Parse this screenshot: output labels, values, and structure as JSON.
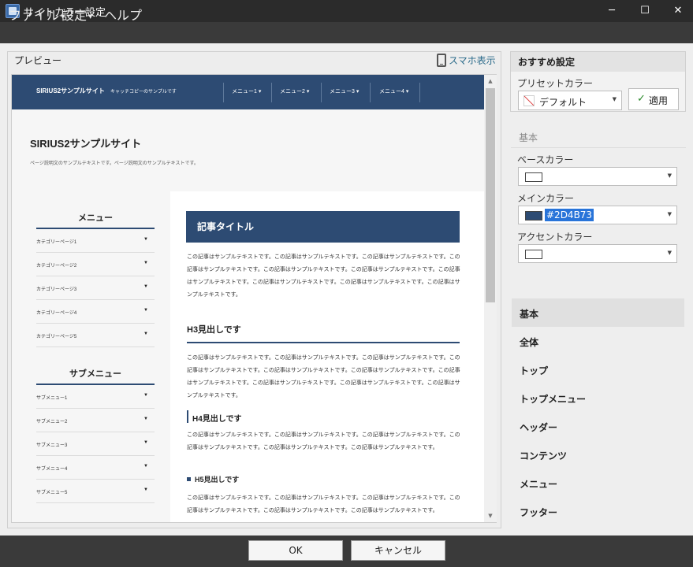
{
  "window": {
    "title": "サイトカラー設定",
    "minimize": "─",
    "maximize": "☐",
    "close": "✕"
  },
  "menubar": {
    "items": [
      "ファイル",
      "設定",
      "ヘルプ"
    ]
  },
  "preview": {
    "label": "プレビュー",
    "smartphone_link": "スマホ表示",
    "site": {
      "name": "SIRIUS2サンプルサイト",
      "catchcopy": "キャッチコピーのサンプルです",
      "nav": [
        "メニュー1",
        "メニュー2",
        "メニュー3",
        "メニュー4"
      ],
      "title": "SIRIUS2サンプルサイト",
      "description": "ページ説明文のサンプルテキストです。ページ説明文のサンプルテキストです。",
      "menu_title": "メニュー",
      "menu_items": [
        "カテゴリーページ1",
        "カテゴリーページ2",
        "カテゴリーページ3",
        "カテゴリーページ4",
        "カテゴリーページ5"
      ],
      "submenu_title": "サブメニュー",
      "submenu_items": [
        "サブメニュー1",
        "サブメニュー2",
        "サブメニュー3",
        "サブメニュー4",
        "サブメニュー5"
      ],
      "article_title": "記事タイトル",
      "para1": "この記事はサンプルテキストです。この記事はサンプルテキストです。この記事はサンプルテキストです。この記事はサンプルテキストです。この記事はサンプルテキストです。この記事はサンプルテキストです。この記事はサンプルテキストです。この記事はサンプルテキストです。この記事はサンプルテキストです。この記事はサンプルテキストです。",
      "h3": "H3見出しです",
      "para2": "この記事はサンプルテキストです。この記事はサンプルテキストです。この記事はサンプルテキストです。この記事はサンプルテキストです。この記事はサンプルテキストです。この記事はサンプルテキストです。この記事はサンプルテキストです。この記事はサンプルテキストです。この記事はサンプルテキストです。この記事はサンプルテキストです。",
      "h4": "H4見出しです",
      "para3": "この記事はサンプルテキストです。この記事はサンプルテキストです。この記事はサンプルテキストです。この記事はサンプルテキストです。この記事はサンプルテキストです。この記事はサンプルテキストです。",
      "h5": "H5見出しです",
      "para4": "この記事はサンプルテキストです。この記事はサンプルテキストです。この記事はサンプルテキストです。この記事はサンプルテキストです。この記事はサンプルテキストです。この記事はサンプルテキストです。"
    }
  },
  "recommend": {
    "title": "おすすめ設定",
    "preset_label": "プリセットカラー",
    "preset_value": "デフォルト",
    "apply_label": "適用"
  },
  "basic": {
    "section": "基本",
    "base_color_label": "ベースカラー",
    "main_color_label": "メインカラー",
    "main_color_value": "#2D4B73",
    "accent_color_label": "アクセントカラー"
  },
  "categories": [
    "基本",
    "全体",
    "トップ",
    "トップメニュー",
    "ヘッダー",
    "コンテンツ",
    "メニュー",
    "フッター"
  ],
  "buttons": {
    "ok": "OK",
    "cancel": "キャンセル"
  },
  "colors": {
    "main": "#2D4B73",
    "base": "#ffffff",
    "accent": "#ffffff"
  }
}
